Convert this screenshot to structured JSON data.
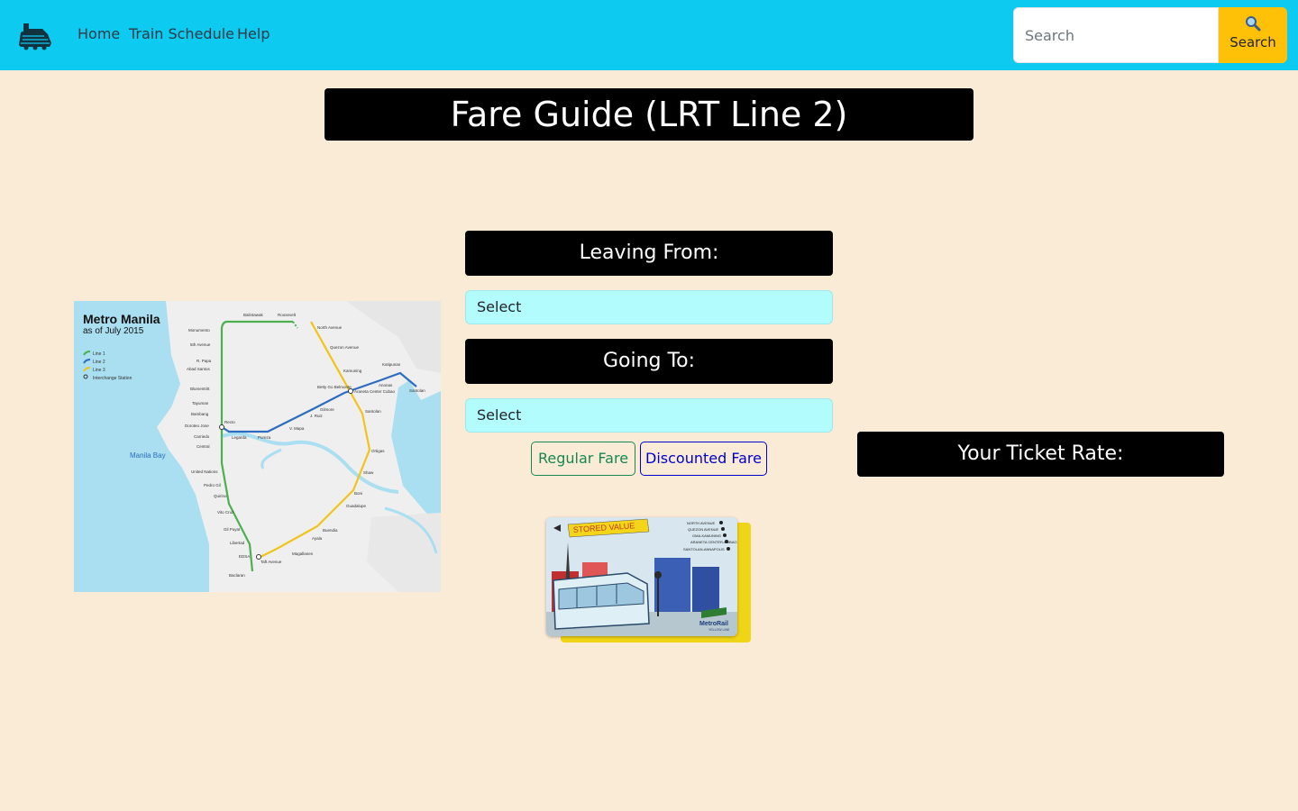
{
  "nav": {
    "links": [
      "Home",
      "Train Schedule",
      "Help"
    ],
    "search_placeholder": "Search",
    "search_button_label": "Search",
    "search_icon": "magnifier-icon",
    "logo_icon": "train-logo-icon"
  },
  "page_title": "Fare Guide (LRT Line 2)",
  "map": {
    "title": "Metro Manila",
    "subtitle": "as of July 2015",
    "legend": [
      "Line 1",
      "Line 2",
      "Line 3",
      "Interchange Station"
    ],
    "bay_label": "Manila Bay",
    "stations": [
      "Monumento",
      "5th Avenue",
      "R. Papa",
      "Abad Santos",
      "Blumentritt",
      "Tayuman",
      "Bambang",
      "Doroteo Jose",
      "Carriedo",
      "Central",
      "United Nations",
      "Pedro Gil",
      "Quirino",
      "Vito Cruz",
      "Gil Puyat",
      "Libertad",
      "EDSA",
      "Baclaran",
      "Balintawak",
      "Roosevelt",
      "North Avenue",
      "Quezon Avenue",
      "Kamuning",
      "Katipunan",
      "Anonas",
      "Santolan",
      "Araneta Center Cubao",
      "Betty Go Belmonte",
      "Gilmore",
      "J. Ruiz",
      "V. Mapa",
      "Pureza",
      "Legarda",
      "Recto",
      "Santolan",
      "Ortigas",
      "Shaw",
      "Boni",
      "Guadalupe",
      "Buendia",
      "Ayala",
      "Magallanes",
      "Taft Avenue"
    ]
  },
  "form": {
    "leaving_label": "Leaving From:",
    "leaving_value": "Select",
    "going_label": "Going To:",
    "going_value": "Select",
    "regular_button": "Regular Fare",
    "discount_button": "Discounted Fare"
  },
  "ticket": {
    "rate_label": "Your Ticket Rate:",
    "card_banner": "STORED VALUE",
    "card_brand": "MetroRail",
    "card_line": "YELLOW LINE",
    "card_stations": [
      "NORTH AVENUE",
      "QUEZON AVENUE",
      "GMA-KAMUNING",
      "ARANETA CENTER-CUBAO",
      "SANTOLAN-ANNAPOLIS"
    ]
  },
  "colors": {
    "navbar": "#0dcaf0",
    "page_bg": "#faebd7",
    "search_button": "#ffc107",
    "select_bg": "#b3fcfe",
    "regular": "#198754",
    "discount": "#0000cc"
  }
}
